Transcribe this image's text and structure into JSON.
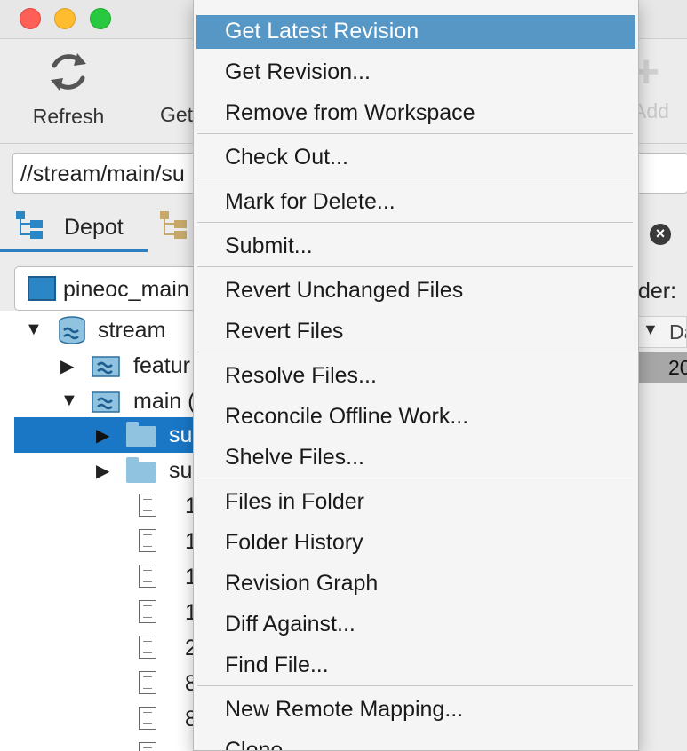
{
  "toolbar": {
    "refresh_label": "Refresh",
    "get_label": "Get",
    "add_label": "Add"
  },
  "path_field": {
    "value": "//stream/main/su"
  },
  "tabs": [
    {
      "label": "Depot",
      "selected": true
    },
    {
      "label": ""
    }
  ],
  "workspace_selector": {
    "value": "pineoc_main"
  },
  "tree": {
    "rows": [
      {
        "label": "stream",
        "expanded": true,
        "type": "stream"
      },
      {
        "label": "featur",
        "expanded": false,
        "type": "stream"
      },
      {
        "label": "main (",
        "expanded": true,
        "type": "stream"
      },
      {
        "label": "su",
        "expanded": false,
        "type": "folder",
        "selected": true
      },
      {
        "label": "su",
        "expanded": false,
        "type": "folder"
      },
      {
        "label": "1",
        "type": "file"
      },
      {
        "label": "1",
        "type": "file"
      },
      {
        "label": "1",
        "type": "file"
      },
      {
        "label": "1",
        "type": "file"
      },
      {
        "label": "2",
        "type": "file"
      },
      {
        "label": "8",
        "type": "file"
      },
      {
        "label": "8",
        "type": "file"
      },
      {
        "label": "",
        "type": "file"
      }
    ]
  },
  "right_pane": {
    "folder_label": "der:",
    "column_header": "Da",
    "row_value": "20"
  },
  "context_menu": {
    "items": [
      {
        "label": "Get Latest Revision",
        "highlighted": true
      },
      {
        "label": "Get Revision..."
      },
      {
        "label": "Remove from Workspace"
      },
      {
        "label": "Check Out..."
      },
      {
        "label": "Mark for Delete..."
      },
      {
        "label": "Submit..."
      },
      {
        "label": "Revert Unchanged Files"
      },
      {
        "label": "Revert Files"
      },
      {
        "label": "Resolve Files..."
      },
      {
        "label": "Reconcile Offline Work..."
      },
      {
        "label": "Shelve Files..."
      },
      {
        "label": "Files in Folder"
      },
      {
        "label": "Folder History"
      },
      {
        "label": "Revision Graph"
      },
      {
        "label": "Diff Against..."
      },
      {
        "label": "Find File..."
      },
      {
        "label": "New Remote Mapping..."
      },
      {
        "label": "Clone..."
      }
    ]
  },
  "colors": {
    "menu_highlight": "#5797c5",
    "tree_selection": "#1977c6",
    "tab_underline": "#2e7fc0"
  }
}
